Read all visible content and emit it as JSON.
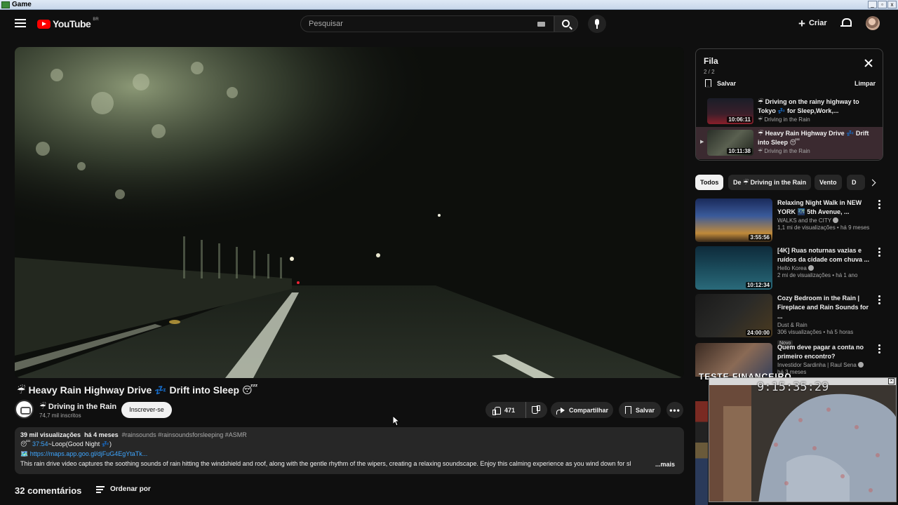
{
  "window": {
    "title": "Game",
    "buttons": [
      "_",
      "▫",
      "x"
    ]
  },
  "topbar": {
    "logo_text": "YouTube",
    "logo_region": "BR",
    "search_placeholder": "Pesquisar",
    "create_label": "Criar"
  },
  "video": {
    "title": "☔ Heavy Rain Highway Drive 💤 Drift into Sleep 😴",
    "channel": "☔ Driving in the Rain",
    "subscribers": "74,7 mil inscritos",
    "subscribe_label": "Inscrever-se",
    "likes": "471",
    "share_label": "Compartilhar",
    "save_label": "Salvar",
    "more_label": "•••"
  },
  "description": {
    "views": "39 mil visualizações",
    "age": "há 4 meses",
    "tags": "#rainsounds #rainsoundsforsleeping #ASMR",
    "line2_time": "37:54",
    "line2_text": "~Loop(Good Night 💤)",
    "line3_link": "https://maps.app.goo.gl/djFuG4EgYtaTk...",
    "line4": "This rain drive video captures the soothing sounds of rain hitting the windshield and roof, along with the gentle rhythm of the wipers, creating a relaxing soundscape. Enjoy this calming experience as you wind down for sl",
    "more": "...mais"
  },
  "comments": {
    "count_label": "32 comentários",
    "sort_label": "Ordenar por"
  },
  "queue": {
    "title": "Fila",
    "count": "2 / 2",
    "save_label": "Salvar",
    "clear_label": "Limpar",
    "items": [
      {
        "title": "☔ Driving on the rainy highway to Tokyo 💤 for Sleep,Work,...",
        "channel": "☔ Driving in the Rain",
        "duration": "10:06:11"
      },
      {
        "title": "☔ Heavy Rain Highway Drive 💤 Drift into Sleep 😴",
        "channel": "☔ Driving in the Rain",
        "duration": "10:11:38"
      }
    ]
  },
  "chips": [
    "Todos",
    "De ☔ Driving in the Rain",
    "Vento",
    "D"
  ],
  "recommendations": [
    {
      "title": "Relaxing Night Walk in NEW YORK 🌃 5th Avenue, ...",
      "channel": "WALKS and the CITY",
      "meta": "1,1 mi de visualizações • há 9 meses",
      "duration": "3:55:56",
      "badge": ""
    },
    {
      "title": "[4K] Ruas noturnas vazias e ruídos da cidade com chuva ...",
      "channel": "Hello Korea",
      "meta": "2 mi de visualizações • há 1 ano",
      "duration": "10:12:34",
      "badge": ""
    },
    {
      "title": "Cozy Bedroom in the Rain | Fireplace and Rain Sounds for ...",
      "channel": "Dust & Rain",
      "meta": "306 visualizações • há 5 horas",
      "duration": "24:00:00",
      "badge": "Novo"
    },
    {
      "title": "Quem deve pagar a conta no primeiro encontro?",
      "channel": "Investidor Sardinha | Raul Sena",
      "meta": "há 3 meses",
      "duration": "",
      "badge": ""
    }
  ],
  "overlay": {
    "clock": "9:15:35:29",
    "banner": "TESTE FINANCEIRO"
  },
  "colors": {
    "background": "#0f0f0f",
    "accent": "#ff0000",
    "link": "#3ea6ff",
    "queue_active": "#3b2a30"
  }
}
